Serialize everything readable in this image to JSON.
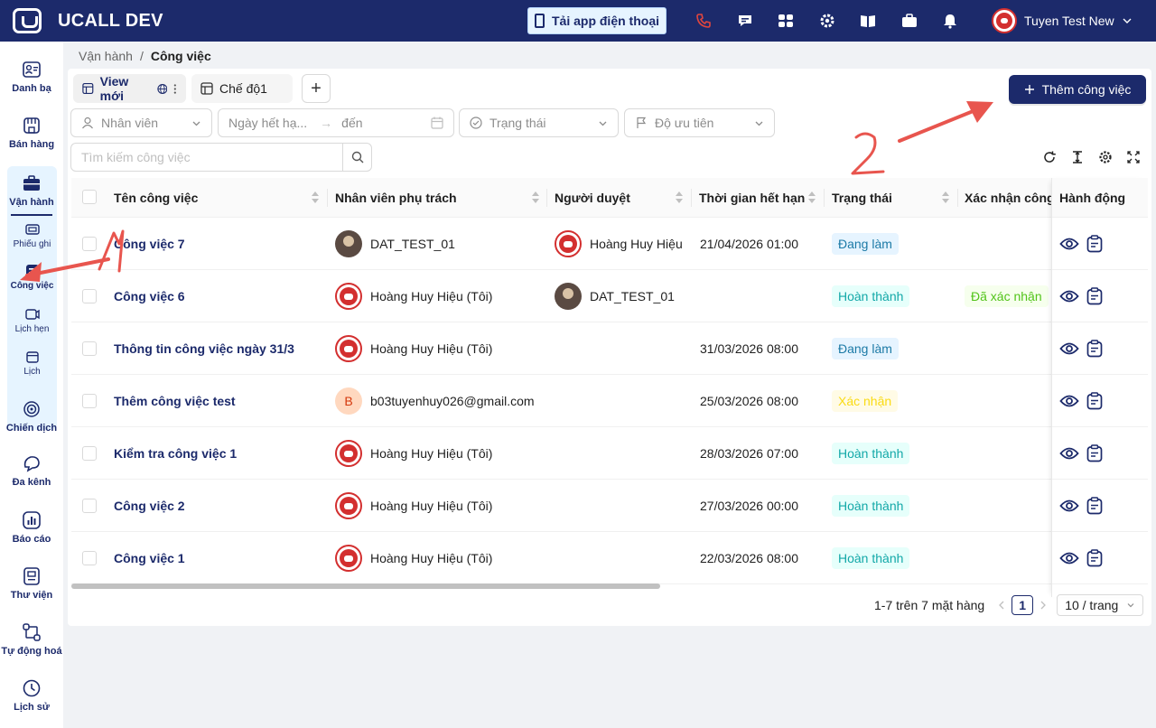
{
  "header": {
    "title": "UCALL DEV",
    "app_button": "Tải app điện thoại",
    "icons": [
      "phone-icon",
      "chat-icon",
      "apps-icon",
      "settings-icon",
      "book-icon",
      "briefcase-icon",
      "bell-icon"
    ],
    "user_name": "Tuyen Test New"
  },
  "sidebar": {
    "items": [
      {
        "label": "Danh bạ",
        "icon": "contacts-icon"
      },
      {
        "label": "Bán hàng",
        "icon": "store-icon"
      },
      {
        "label": "Vận hành",
        "icon": "toolbox-icon"
      },
      {
        "label": "Chiến dịch",
        "icon": "target-icon"
      },
      {
        "label": "Đa kênh",
        "icon": "omnichannel-icon"
      },
      {
        "label": "Báo cáo",
        "icon": "report-icon"
      },
      {
        "label": "Thư viện",
        "icon": "library-icon"
      },
      {
        "label": "Tự động hoá",
        "icon": "automation-icon"
      },
      {
        "label": "Lịch sử",
        "icon": "history-icon"
      }
    ],
    "sub_items": [
      {
        "label": "Phiếu ghi",
        "icon": "ticket-icon"
      },
      {
        "label": "Công việc",
        "icon": "task-icon"
      },
      {
        "label": "Lịch hẹn",
        "icon": "appointment-icon"
      },
      {
        "label": "Lịch",
        "icon": "calendar-icon"
      }
    ]
  },
  "breadcrumb": {
    "parent": "Vận hành",
    "separator": "/",
    "current": "Công việc"
  },
  "views": {
    "tabs": [
      {
        "label": "View mới",
        "active": true
      },
      {
        "label": "Chế độ1",
        "active": false
      }
    ],
    "add": "+"
  },
  "add_task_button": "Thêm công việc",
  "filters": {
    "employee": "Nhân viên",
    "due_from": "Ngày hết hạ...",
    "arrow": "→",
    "due_to": "đến",
    "status": "Trạng thái",
    "priority": "Độ ưu tiên"
  },
  "search": {
    "placeholder": "Tìm kiếm công việc"
  },
  "table": {
    "columns": [
      "Tên công việc",
      "Nhân viên phụ trách",
      "Người duyệt",
      "Thời gian hết hạn",
      "Trạng thái",
      "Xác nhận công",
      "Hành động"
    ],
    "rows": [
      {
        "name": "Công việc 7",
        "assignee": "DAT_TEST_01",
        "assignee_avatar": "dark",
        "reviewer": "Hoàng Huy Hiệu",
        "reviewer_avatar": "red",
        "due": "21/04/2026 01:00",
        "status": "Đang làm",
        "status_kind": "doing",
        "confirm": ""
      },
      {
        "name": "Công việc 6",
        "assignee": "Hoàng Huy Hiệu (Tôi)",
        "assignee_avatar": "red",
        "reviewer": "DAT_TEST_01",
        "reviewer_avatar": "dark",
        "due": "",
        "status": "Hoàn thành",
        "status_kind": "done",
        "confirm": "Đã xác nhận"
      },
      {
        "name": "Thông tin công việc ngày 31/3",
        "assignee": "Hoàng Huy Hiệu (Tôi)",
        "assignee_avatar": "red",
        "reviewer": "",
        "reviewer_avatar": "",
        "due": "31/03/2026 08:00",
        "status": "Đang làm",
        "status_kind": "doing",
        "confirm": ""
      },
      {
        "name": "Thêm công việc test",
        "assignee": "b03tuyenhuy026@gmail.com",
        "assignee_avatar": "letter",
        "avatar_letter": "B",
        "reviewer": "",
        "reviewer_avatar": "",
        "due": "25/03/2026 08:00",
        "status": "Xác nhận",
        "status_kind": "confirm",
        "confirm": ""
      },
      {
        "name": "Kiểm tra công việc 1",
        "assignee": "Hoàng Huy Hiệu (Tôi)",
        "assignee_avatar": "red",
        "reviewer": "",
        "reviewer_avatar": "",
        "due": "28/03/2026 07:00",
        "status": "Hoàn thành",
        "status_kind": "done",
        "confirm": ""
      },
      {
        "name": "Công việc 2",
        "assignee": "Hoàng Huy Hiệu (Tôi)",
        "assignee_avatar": "red",
        "reviewer": "",
        "reviewer_avatar": "",
        "due": "27/03/2026 00:00",
        "status": "Hoàn thành",
        "status_kind": "done",
        "confirm": ""
      },
      {
        "name": "Công việc 1",
        "assignee": "Hoàng Huy Hiệu (Tôi)",
        "assignee_avatar": "red",
        "reviewer": "",
        "reviewer_avatar": "",
        "due": "22/03/2026 08:00",
        "status": "Hoàn thành",
        "status_kind": "done",
        "confirm": ""
      }
    ]
  },
  "pagination": {
    "summary": "1-7 trên 7 mặt hàng",
    "current_page": "1",
    "page_size": "10 / trang"
  },
  "annotations": {
    "number_1": "1",
    "number_2": "2",
    "color": "#e8554e"
  },
  "colors": {
    "brand": "#1c2a6b",
    "accent_light": "#e6f4ff"
  }
}
